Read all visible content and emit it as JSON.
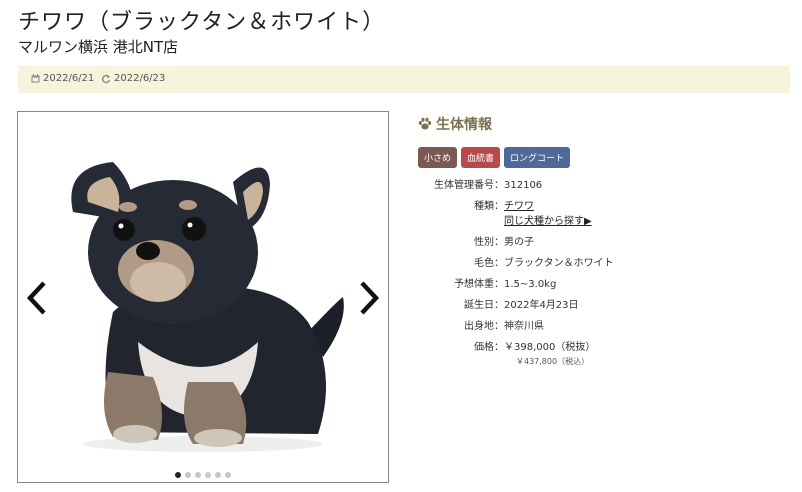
{
  "page": {
    "title": "チワワ（ブラックタン＆ホワイト）",
    "subtitle": "マルワン横浜 港北NT店"
  },
  "dates": {
    "posted_icon": "calendar-icon",
    "posted": "2022/6/21",
    "updated_icon": "refresh-icon",
    "updated": "2022/6/23"
  },
  "gallery": {
    "photo": "black-and-tan-chihuahua-puppy",
    "dot_count": 6,
    "active_dot": 1
  },
  "info": {
    "heading_icon": "paw-icon",
    "heading": "生体情報",
    "tags": [
      {
        "label": "小さめ",
        "color": "#7b5a52"
      },
      {
        "label": "血統書",
        "color": "#b84a4a"
      },
      {
        "label": "ロングコート",
        "color": "#4f6a99"
      }
    ],
    "rows": [
      {
        "key": "生体管理番号：",
        "value": "312106"
      },
      {
        "key": "種類：",
        "value": "チワワ",
        "link": "同じ犬種から探す▶"
      },
      {
        "key": "性別：",
        "value": "男の子"
      },
      {
        "key": "毛色：",
        "value": "ブラックタン＆ホワイト"
      },
      {
        "key": "予想体重：",
        "value": "1.5~3.0kg"
      },
      {
        "key": "誕生日：",
        "value": "2022年4月23日"
      },
      {
        "key": "出身地：",
        "value": "神奈川県"
      },
      {
        "key": "価格：",
        "value": "￥398,000（税抜）",
        "sub": "￥437,800（税込）"
      }
    ]
  }
}
